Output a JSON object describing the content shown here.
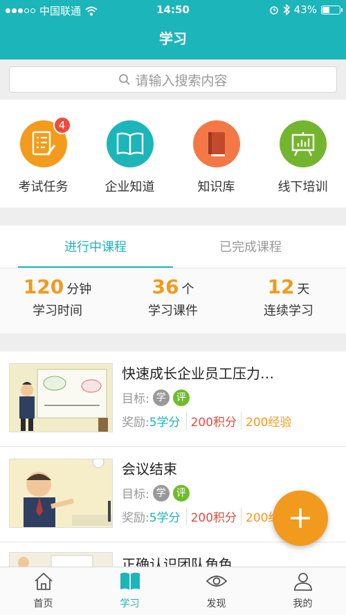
{
  "status_bar": {
    "carrier": "中国联通",
    "time": "14:50",
    "battery": "43%",
    "battery_level": 0.43
  },
  "nav": {
    "title": "学习"
  },
  "search": {
    "placeholder": "请输入搜索内容"
  },
  "quick_actions": [
    {
      "label": "考试任务",
      "icon": "checklist-icon",
      "color": "#f39b1c",
      "badge": "4"
    },
    {
      "label": "企业知道",
      "icon": "open-book-icon",
      "color": "#1cb5ba"
    },
    {
      "label": "知识库",
      "icon": "closed-book-icon",
      "color": "#f47846"
    },
    {
      "label": "线下培训",
      "icon": "presentation-board-icon",
      "color": "#74b52e"
    }
  ],
  "tabs": {
    "active": "进行中课程",
    "inactive": "已完成课程"
  },
  "stats": [
    {
      "value": "120",
      "unit": "分钟",
      "label": "学习时间"
    },
    {
      "value": "36",
      "unit": "个",
      "label": "学习课件"
    },
    {
      "value": "12",
      "unit": "天",
      "label": "连续学习"
    }
  ],
  "courses": [
    {
      "title": "快速成长企业员工压力…",
      "goal_label": "目标:",
      "tags": [
        "学",
        "评"
      ],
      "reward_label": "奖励:",
      "credits": "5学分",
      "points": "200积分",
      "exp": "200经验"
    },
    {
      "title": "会议结束",
      "goal_label": "目标:",
      "tags": [
        "学",
        "评"
      ],
      "reward_label": "奖励:",
      "credits": "5学分",
      "points": "200积分",
      "exp": "200经验"
    },
    {
      "title": "正确认识团队角色"
    }
  ],
  "tabbar": [
    {
      "label": "首页",
      "icon": "home-icon"
    },
    {
      "label": "学习",
      "icon": "book-icon"
    },
    {
      "label": "发现",
      "icon": "eye-icon"
    },
    {
      "label": "我的",
      "icon": "user-icon"
    }
  ],
  "colors": {
    "primary": "#1cb5ba",
    "orange": "#f29a1d",
    "red": "#e84a3c",
    "green": "#6dbd2b"
  }
}
